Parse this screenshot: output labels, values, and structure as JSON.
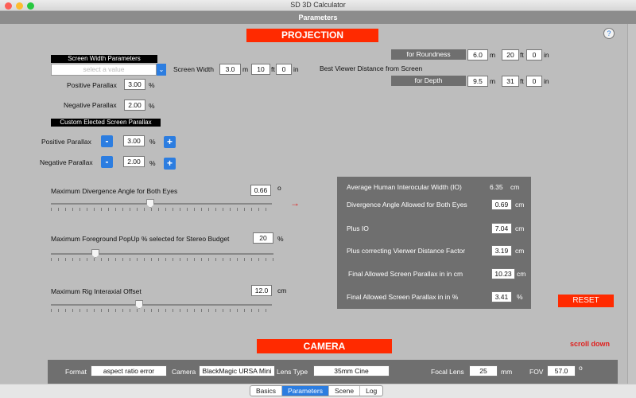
{
  "window": {
    "title": "SD 3D Calculator"
  },
  "navbar": {
    "title": "Parameters"
  },
  "projection": {
    "header": "PROJECTION",
    "screen_width_params_label": "Screen Width Parameters",
    "select_placeholder": "select a value",
    "screen_width_label": "Screen Width",
    "screen_width_m": "3.0",
    "m_unit": "m",
    "screen_width_ft": "10",
    "ft_unit": "ft",
    "screen_width_in": "0",
    "in_unit": "in",
    "positive_parallax_label": "Positive Parallax",
    "positive_parallax": "3.00",
    "negative_parallax_label": "Negative Parallax",
    "negative_parallax": "2.00",
    "percent": "%",
    "custom_label": "Custom Elected Screen Parallax",
    "custom_positive_label": "Positive Parallax",
    "custom_positive": "3.00",
    "custom_negative_label": "Negative Parallax",
    "custom_negative": "2.00",
    "minus": "-",
    "plus": "+",
    "best_viewer_label": "Best Viewer Distance from Screen",
    "roundness_label": "for Roundness",
    "roundness_m": "6.0",
    "roundness_ft": "20",
    "roundness_in": "0",
    "depth_label": "for Depth",
    "depth_m": "9.5",
    "depth_ft": "31",
    "depth_in": "0",
    "help": "?"
  },
  "sliders": {
    "divergence_label": "Maximum Divergence Angle for Both Eyes",
    "divergence_value": "0.66",
    "divergence_unit": "o",
    "divergence_level": 0.45,
    "popup_label": "Maximum Foreground PopUp % selected for Stereo Budget",
    "popup_value": "20",
    "popup_unit": "%",
    "popup_level": 0.2,
    "rig_label": "Maximum Rig Interaxial Offset",
    "rig_value": "12.0",
    "rig_unit": "cm",
    "rig_level": 0.4
  },
  "results": {
    "arrow": "→",
    "io_label": "Average Human Interocular Width (IO)",
    "io_value": "6.35",
    "io_unit": "cm",
    "divergence_label": "Divergence Angle Allowed for Both Eyes",
    "divergence_value": "0.69",
    "divergence_unit": "cm",
    "plus_io_label": "Plus IO",
    "plus_io_value": "7.04",
    "plus_io_unit": "cm",
    "factor_label": "Plus correcting Vierwer Distance Factor",
    "factor_value": "3.19",
    "factor_unit": "cm",
    "final_cm_label": "Final Allowed Screen Parallax in in cm",
    "final_cm_value": "10.23",
    "final_cm_unit": "cm",
    "final_pct_label": "Final Allowed Screen Parallax in in %",
    "final_pct_value": "3.41",
    "final_pct_unit": "%",
    "reset_label": "RESET"
  },
  "camera": {
    "header": "CAMERA",
    "scroll_hint": "scroll down",
    "format_label": "Format",
    "format_value": "aspect ratio error",
    "camera_label": "Camera",
    "camera_value": "BlackMagic URSA Mini",
    "lens_type_label": "Lens Type",
    "lens_type_value": "35mm Cine",
    "focal_label": "Focal Lens",
    "focal_value": "25",
    "focal_unit": "mm",
    "fov_label": "FOV",
    "fov_value": "57.0",
    "fov_unit": "o"
  },
  "tabs": [
    "Basics",
    "Parameters",
    "Scene",
    "Log"
  ],
  "colors": {
    "accent_red": "#ff2a00",
    "accent_blue": "#2c7de0",
    "panel_gray": "#6f6f6f"
  }
}
